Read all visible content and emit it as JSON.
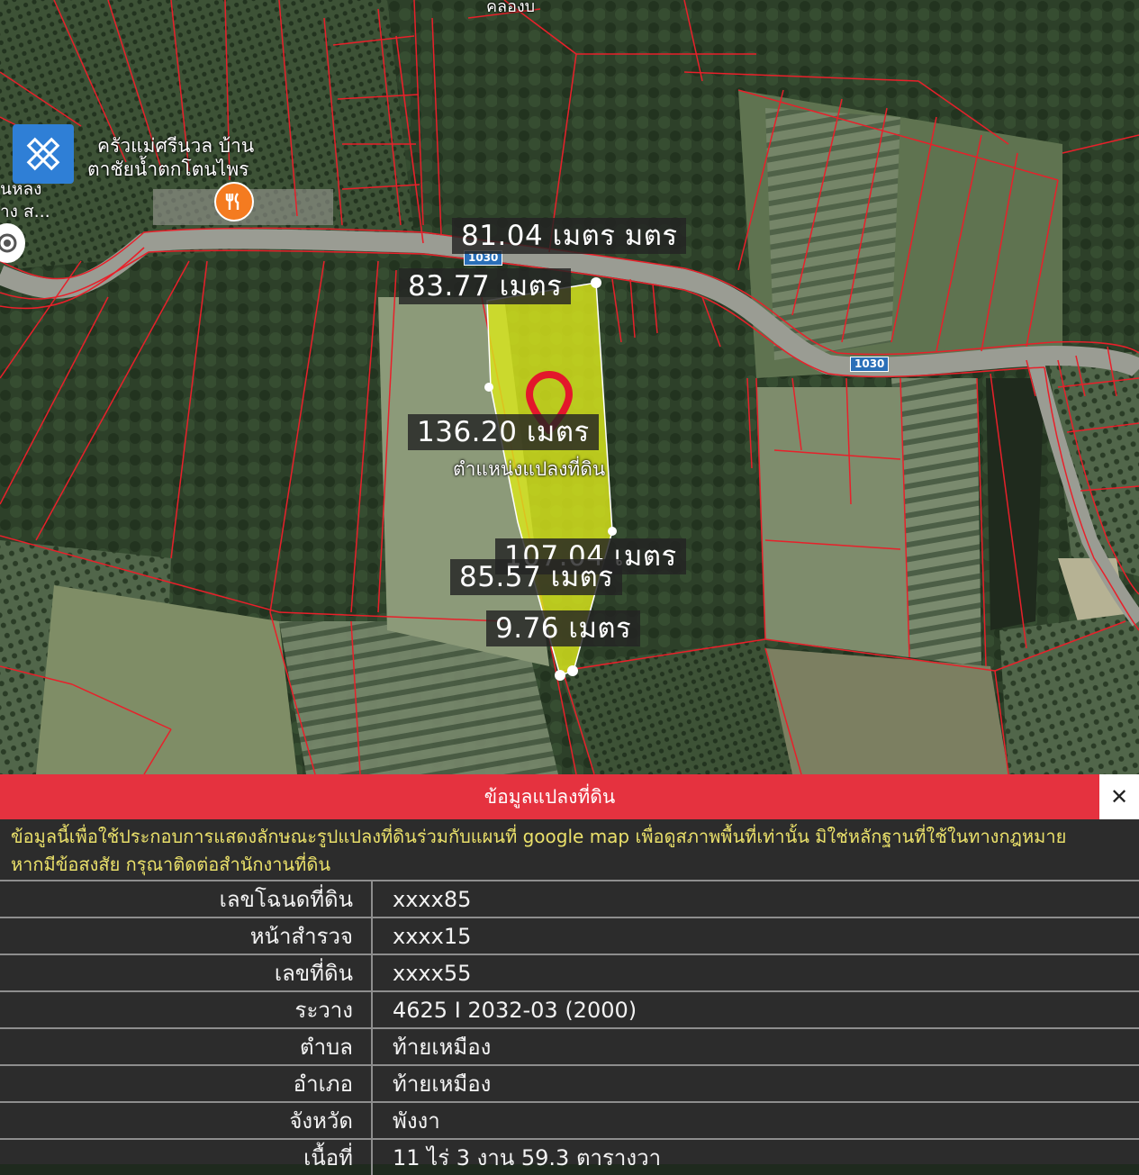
{
  "map": {
    "places": {
      "restaurant_line1": "ครัวแม่ศรีนวล บ้าน",
      "restaurant_line2": "ตาชัยน้ำตกโตนไพร",
      "left_line1": "นหลง",
      "left_line2": "าง ส...",
      "top_text": "คลองบ"
    },
    "road_shield": "1030",
    "pin_label": "ตำแหน่งแปลงที่ดิน",
    "measurements": {
      "top_a": "81.04 เมตร มตร",
      "top_b": "83.77 เมตร",
      "side": "136.20 เมตร",
      "right": "107.04 เมตร",
      "bottom_left": "85.57 เมตร",
      "tip": "9.76 เมตร"
    },
    "colors": {
      "boundary": "#e8202a",
      "parcel_fill": "#d9e61c",
      "pin": "#e3172b"
    }
  },
  "panel": {
    "title": "ข้อมูลแปลงที่ดิน",
    "close": "✕",
    "notice_line1": "ข้อมูลนี้เพื่อใช้ประกอบการแสดงลักษณะรูปแปลงที่ดินร่วมกับแผนที่ google map เพื่อดูสภาพพื้นที่เท่านั้น มิใช่หลักฐานที่ใช้ในทางกฎหมาย",
    "notice_line2": "หากมีข้อสงสัย กรุณาติดต่อสำนักงานที่ดิน",
    "rows": [
      {
        "label": "เลขโฉนดที่ดิน",
        "value": "xxxx85"
      },
      {
        "label": "หน้าสำรวจ",
        "value": "xxxx15"
      },
      {
        "label": "เลขที่ดิน",
        "value": "xxxx55"
      },
      {
        "label": "ระวาง",
        "value": "4625 I 2032-03 (2000)"
      },
      {
        "label": "ตำบล",
        "value": "ท้ายเหมือง"
      },
      {
        "label": "อำเภอ",
        "value": "ท้ายเหมือง"
      },
      {
        "label": "จังหวัด",
        "value": "พังงา"
      },
      {
        "label": "เนื้อที่",
        "value": "11 ไร่ 3 งาน 59.3 ตารางวา"
      }
    ]
  }
}
